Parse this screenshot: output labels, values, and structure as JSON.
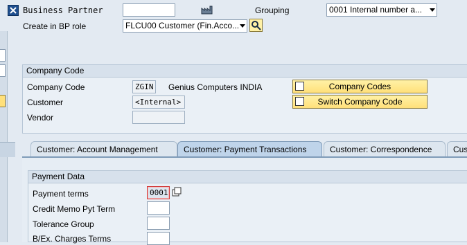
{
  "header": {
    "bp_label": "Business Partner",
    "bp_value": "",
    "grouping_label": "Grouping",
    "grouping_value": "0001 Internal number a...",
    "role_label": "Create in BP role",
    "role_value": "FLCU00 Customer (Fin.Acco..."
  },
  "company_code_section": {
    "title": "Company Code",
    "company_code_label": "Company Code",
    "company_code_value": "ZGIN",
    "company_name": "Genius Computers INDIA",
    "customer_label": "Customer",
    "customer_value": "<Internal>",
    "vendor_label": "Vendor",
    "vendor_value": "",
    "btn_company_codes": "Company Codes",
    "btn_switch_company_code": "Switch Company Code"
  },
  "tabs": [
    {
      "label": "Customer: Account Management"
    },
    {
      "label": "Customer: Payment Transactions"
    },
    {
      "label": "Customer: Correspondence"
    },
    {
      "label": "Cus"
    }
  ],
  "payment_data": {
    "title": "Payment Data",
    "payment_terms_label": "Payment terms",
    "payment_terms_value": "0001",
    "credit_memo_label": "Credit Memo Pyt Term",
    "tolerance_group_label": "Tolerance Group",
    "bex_charges_label": "B/Ex. Charges Terms"
  },
  "icons": {
    "bp_toggle": "close-x-icon",
    "org_icon": "factory-icon",
    "search": "search-icon"
  },
  "colors": {
    "background": "#e3eaf2",
    "button_yellow": "#ffe07a",
    "active_tab": "#bfd4ea"
  }
}
